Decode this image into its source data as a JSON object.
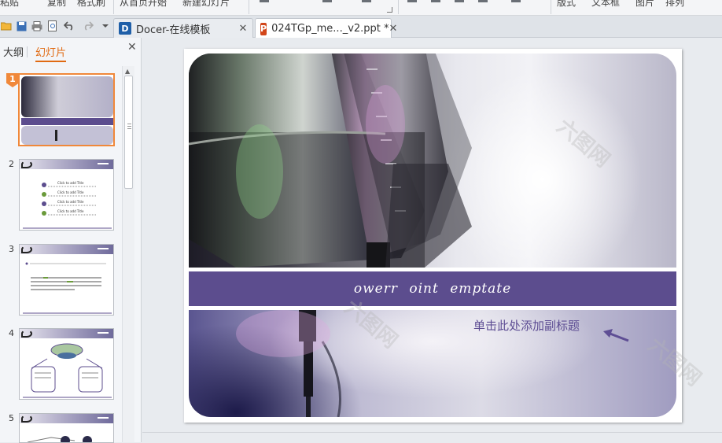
{
  "ribbon": {
    "fragments": [
      "粘贴",
      "复制",
      "格式刷",
      "从首页开始",
      "新建幻灯片",
      "版式",
      "文本框",
      "图片",
      "排列"
    ]
  },
  "quick_access_icons": [
    "open-folder-icon",
    "save-icon",
    "print-icon",
    "print-preview-icon",
    "undo-icon",
    "redo-icon",
    "customize-dropdown-icon"
  ],
  "tabs": [
    {
      "label": "Docer-在线模板",
      "icon": "docer-icon",
      "icon_glyph": "D",
      "icon_color": "#1f5fa8"
    },
    {
      "label": "024TGp_me..._v2.ppt *",
      "icon": "ppt-icon",
      "icon_glyph": "P",
      "icon_color": "#d2461a"
    }
  ],
  "new_tab_glyph": "+",
  "close_glyph": "✕",
  "sidebar": {
    "tabs": [
      "大纲",
      "幻灯片"
    ],
    "active_tab": "幻灯片",
    "thumbnails": [
      {
        "number": "1",
        "selected": true
      },
      {
        "number": "2",
        "selected": false,
        "items": [
          "Click to add Title",
          "Click to add Title",
          "Click to add Title",
          "Click to add Title"
        ]
      },
      {
        "number": "3",
        "selected": false
      },
      {
        "number": "4",
        "selected": false
      },
      {
        "number": "5",
        "selected": false
      }
    ]
  },
  "slide": {
    "title": "owerr oint emptate",
    "subtitle": "单击此处添加副标题"
  },
  "colors": {
    "accent_orange": "#f0883a",
    "title_band": "#5c4d8e",
    "subtitle_text": "#5e4e94",
    "arrow": "#5e4e94"
  }
}
